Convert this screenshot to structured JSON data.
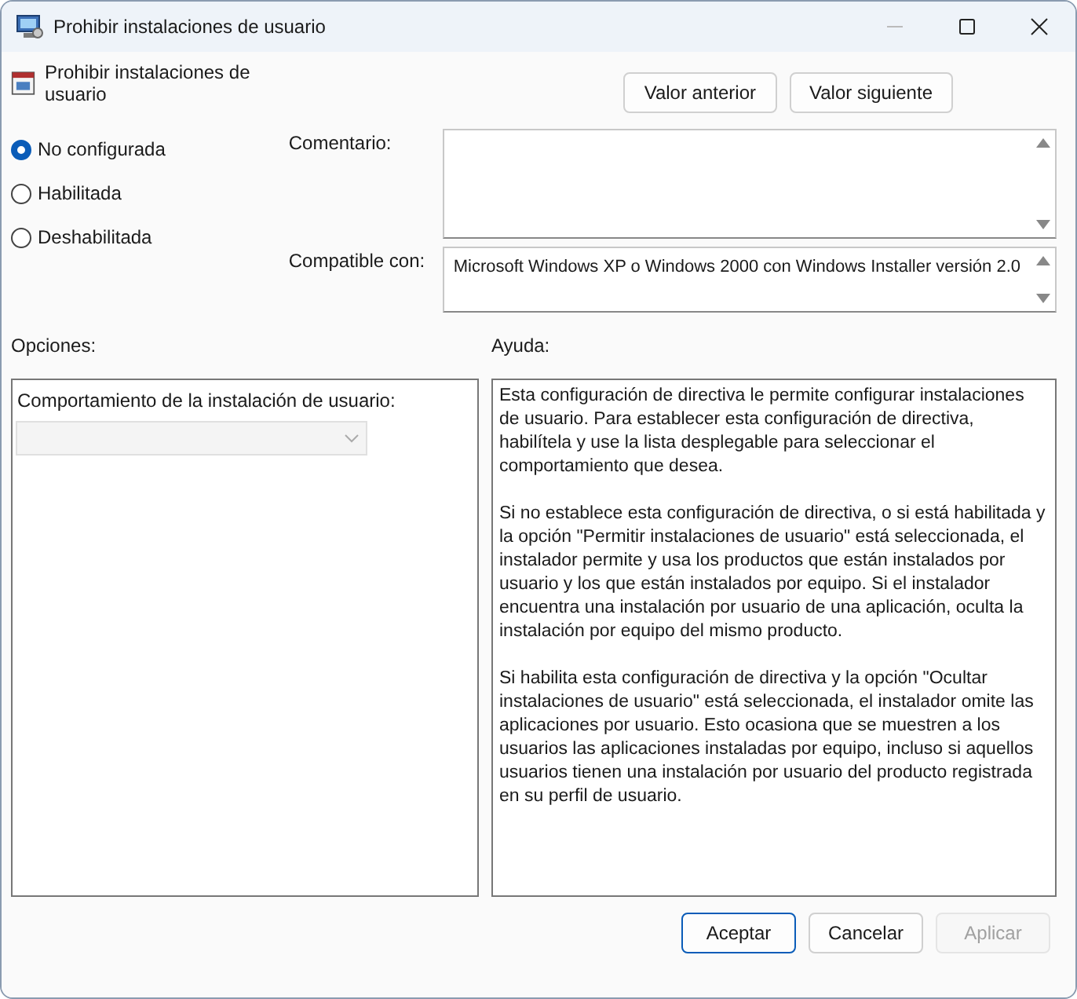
{
  "window": {
    "title": "Prohibir instalaciones de usuario"
  },
  "header": {
    "title": "Prohibir instalaciones de usuario",
    "buttons": [
      "Valor anterior",
      "Valor siguiente"
    ]
  },
  "states": [
    {
      "label": "No configurada",
      "selected": true
    },
    {
      "label": "Habilitada",
      "selected": false
    },
    {
      "label": "Deshabilitada",
      "selected": false
    }
  ],
  "comment": {
    "label": "Comentario:"
  },
  "compatible": {
    "label": "Compatible con:",
    "value": "Microsoft Windows XP o Windows 2000 con Windows Installer versión 2.0"
  },
  "options": {
    "label": "Opciones:",
    "field_label": "Comportamiento de la instalación de usuario:",
    "dropdown_disabled": true
  },
  "help": {
    "label": "Ayuda:",
    "paragraphs": [
      "Esta configuración de directiva le permite configurar instalaciones de usuario. Para establecer esta configuración de directiva, habilítela y use la lista desplegable para seleccionar el comportamiento que desea.",
      "Si no establece esta configuración de directiva, o si está habilitada y la opción \"Permitir instalaciones de usuario\" está seleccionada, el instalador permite y usa los productos que están instalados por usuario y los que están instalados por equipo. Si el instalador encuentra una instalación por usuario de una aplicación, oculta la instalación por equipo del mismo producto.",
      "Si habilita esta configuración de directiva y la opción \"Ocultar instalaciones de usuario\" está seleccionada, el instalador omite las aplicaciones por usuario. Esto ocasiona que se muestren a los usuarios las aplicaciones instaladas por equipo, incluso si aquellos usuarios tienen una instalación por usuario del producto registrada en su perfil de usuario."
    ]
  },
  "footer": [
    {
      "label": "Aceptar",
      "kind": "default",
      "disabled": false
    },
    {
      "label": "Cancelar",
      "kind": "normal",
      "disabled": false
    },
    {
      "label": "Aplicar",
      "kind": "normal",
      "disabled": true
    }
  ]
}
